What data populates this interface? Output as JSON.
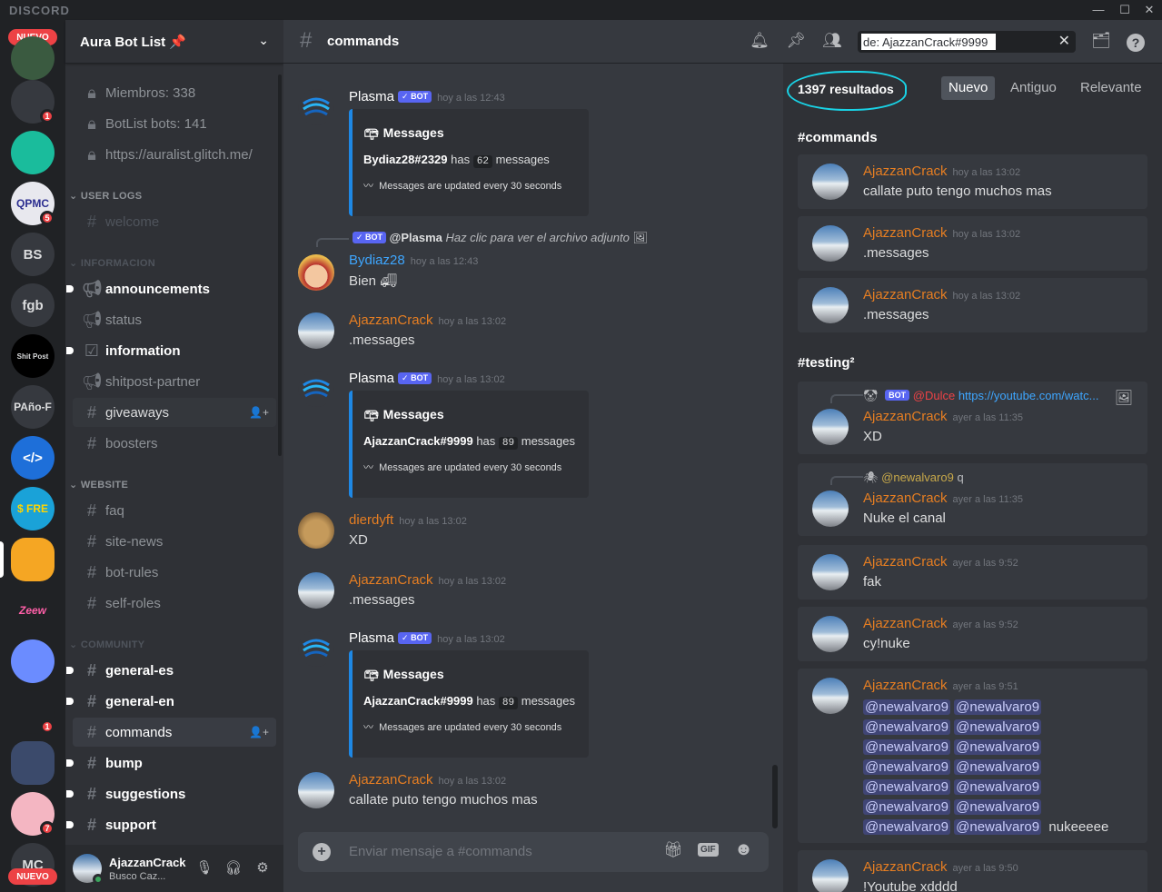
{
  "app": {
    "wordmark": "DISCORD"
  },
  "window": {
    "minimize": "—",
    "maximize": "☐",
    "close": "✕"
  },
  "guild_rail": {
    "new_badge": "NUEVO",
    "items": [
      {
        "label": "",
        "badge": ""
      },
      {
        "label": "",
        "badge": "1"
      },
      {
        "label": "",
        "badge": ""
      },
      {
        "label": "QPMC",
        "badge": "5"
      },
      {
        "label": "BS",
        "badge": ""
      },
      {
        "label": "fgb",
        "badge": ""
      },
      {
        "label": "Shit Post",
        "badge": ""
      },
      {
        "label": "PAño-F",
        "badge": ""
      },
      {
        "label": "</>",
        "badge": ""
      },
      {
        "label": "$ FRE",
        "badge": ""
      },
      {
        "label": "",
        "badge": ""
      },
      {
        "label": "Zeew",
        "badge": ""
      },
      {
        "label": "",
        "badge": ""
      },
      {
        "label": "",
        "badge": "1"
      },
      {
        "label": "",
        "badge": ""
      },
      {
        "label": "",
        "badge": "7"
      },
      {
        "label": "MC",
        "badge": ""
      }
    ]
  },
  "sidebar": {
    "guild_name": "Aura Bot List 📌",
    "locked": [
      "Miembros: 338",
      "BotList bots: 141",
      "https://auralist.glitch.me/"
    ],
    "categories": {
      "user_logs": "USER LOGS",
      "informacion": "INFORMACION",
      "website": "WEBSITE",
      "community": "COMMUNITY"
    },
    "channels": {
      "welcome": "welcome",
      "announcements": "announcements",
      "status": "status",
      "information": "information",
      "shitpost": "shitpost-partner",
      "giveaways": "giveaways",
      "boosters": "boosters",
      "faq": "faq",
      "site_news": "site-news",
      "bot_rules": "bot-rules",
      "self_roles": "self-roles",
      "general_es": "general-es",
      "general_en": "general-en",
      "commands": "commands",
      "bump": "bump",
      "suggestions": "suggestions",
      "support": "support"
    }
  },
  "user_panel": {
    "name": "AjazzanCrack",
    "status": "Busco Caz..."
  },
  "header": {
    "hash": "#",
    "channel": "commands",
    "search_value": "de: AjazzanCrack#9999"
  },
  "messages": {
    "bot": "BOT",
    "embed_title": "Messages",
    "embed_foot": "Messages are updated every 30 seconds",
    "m1": {
      "author": "Plasma",
      "time": "hoy a las 12:43",
      "user": "Bydiaz28#2329",
      "has": "has",
      "count": "62",
      "suffix": "messages"
    },
    "reply_author": "@Plasma",
    "reply_text": "Haz clic para ver el archivo adjunto",
    "m2": {
      "author": "Bydiaz28",
      "time": "hoy a las 12:43",
      "text": "Bien"
    },
    "m3": {
      "author": "AjazzanCrack",
      "time": "hoy a las 13:02",
      "text": ".messages"
    },
    "m4": {
      "author": "Plasma",
      "time": "hoy a las 13:02",
      "user": "AjazzanCrack#9999",
      "has": "has",
      "count": "89",
      "suffix": "messages"
    },
    "m5": {
      "author": "dierdyft",
      "time": "hoy a las 13:02",
      "text": "XD"
    },
    "m6": {
      "author": "AjazzanCrack",
      "time": "hoy a las 13:02",
      "text": ".messages"
    },
    "m7": {
      "author": "Plasma",
      "time": "hoy a las 13:02",
      "user": "AjazzanCrack#9999",
      "has": "has",
      "count": "89",
      "suffix": "messages"
    },
    "m8": {
      "author": "AjazzanCrack",
      "time": "hoy a las 13:02",
      "text": "callate puto tengo muchos mas"
    }
  },
  "composer": {
    "placeholder": "Enviar mensaje a #commands",
    "gif": "GIF"
  },
  "results": {
    "count": "1397 resultados",
    "sort": [
      "Nuevo",
      "Antiguo",
      "Relevante"
    ],
    "group1": "#commands",
    "group2": "#testing²",
    "author": "AjazzanCrack",
    "r1": {
      "time": "hoy a las 13:02",
      "text": "callate puto tengo muchos mas"
    },
    "r2": {
      "time": "hoy a las 13:02",
      "text": ".messages"
    },
    "r3": {
      "time": "hoy a las 13:02",
      "text": ".messages"
    },
    "r4": {
      "reply_user": "@Dulce",
      "reply_link": "https://youtube.com/watc...",
      "time": "ayer a las 11:35",
      "text": "XD"
    },
    "r5": {
      "reply_user": "@newalvaro9",
      "reply_text": "q",
      "time": "ayer a las 11:35",
      "text": "Nuke el canal"
    },
    "r6": {
      "time": "ayer a las 9:52",
      "text": "fak"
    },
    "r7": {
      "time": "ayer a las 9:52",
      "text": "cy!nuke"
    },
    "r8": {
      "time": "ayer a las 9:51",
      "mention": "@newalvaro9",
      "tail": "nukeeeee"
    },
    "r9": {
      "time": "ayer a las 9:50",
      "text": "!Youtube xdddd"
    }
  },
  "colors": {
    "accent": "#5865f2",
    "author_orange": "#e67e22",
    "link_blue": "#3ea6ff",
    "embed_border": "#1e88e5",
    "highlight_ring": "#19d3e6"
  }
}
